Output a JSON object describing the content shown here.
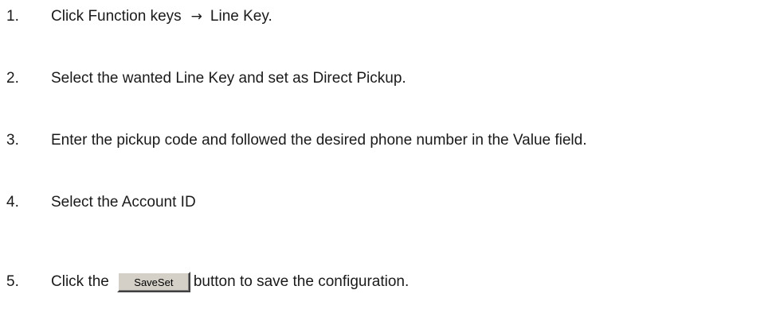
{
  "steps": [
    {
      "number": "1.",
      "text_before": "Click Function keys",
      "arrow": "→",
      "text_after": "Line Key."
    },
    {
      "number": "2.",
      "text": "Select the wanted Line Key and set as Direct Pickup."
    },
    {
      "number": "3.",
      "text": "Enter the pickup code and followed the desired phone number in the Value field."
    },
    {
      "number": "4.",
      "text": "Select the Account ID"
    },
    {
      "number": "5.",
      "text_before": "Click the",
      "button_label": "SaveSet",
      "text_after": "button to save the configuration."
    }
  ]
}
